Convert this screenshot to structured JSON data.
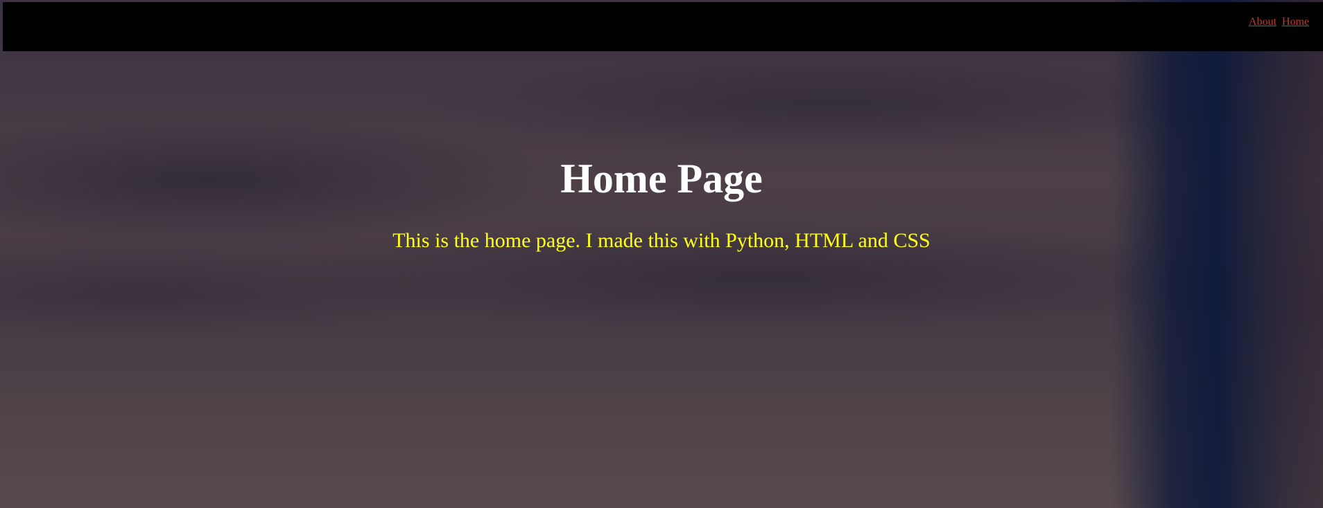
{
  "nav": {
    "links": [
      {
        "label": "About"
      },
      {
        "label": "Home"
      }
    ]
  },
  "hero": {
    "title": "Home Page",
    "subtitle": "This is the home page. I made this with Python, HTML and CSS"
  },
  "colors": {
    "navbar_bg": "#000000",
    "link": "#c0392b",
    "title": "#ffffff",
    "subtitle": "#ffff1a"
  }
}
